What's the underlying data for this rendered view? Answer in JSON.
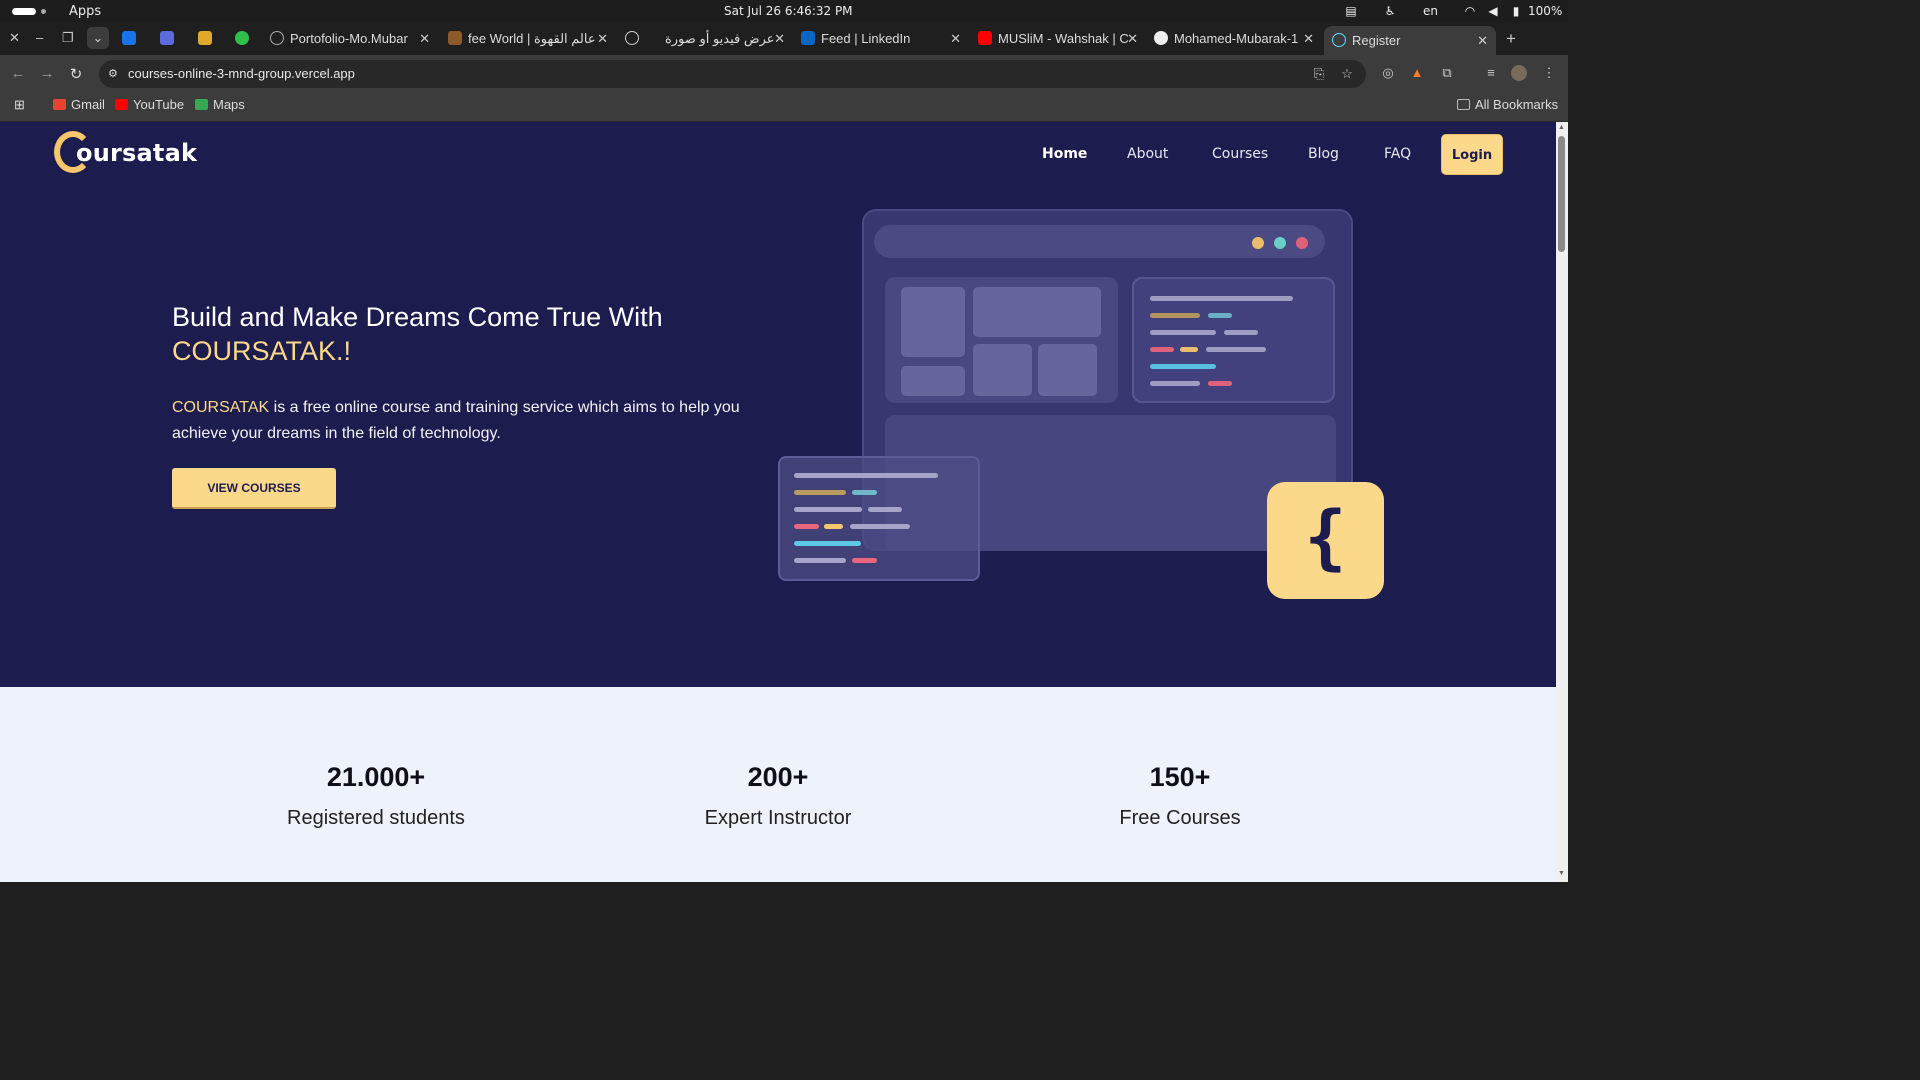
{
  "os": {
    "apps_label": "Apps",
    "clock": "Sat Jul 26   6:46:32 PM",
    "lang": "en",
    "battery": "100%"
  },
  "tabs": [
    {
      "label": "Portofolio-Mo.Mubar"
    },
    {
      "label": "fee World | عالم القهوة"
    },
    {
      "label": "عرض فيديو أو صورة"
    },
    {
      "label": "Feed | LinkedIn"
    },
    {
      "label": "MUSliM - Wahshak | C"
    },
    {
      "label": "Mohamed-Mubarak-1"
    },
    {
      "label": "Register"
    }
  ],
  "address_bar": {
    "url": "courses-online-3-mnd-group.vercel.app"
  },
  "bookmarks": {
    "items": [
      {
        "label": "Gmail"
      },
      {
        "label": "YouTube"
      },
      {
        "label": "Maps"
      }
    ],
    "all_bookmarks": "All Bookmarks"
  },
  "site": {
    "logo_text": "oursatak",
    "nav": {
      "home": "Home",
      "about": "About",
      "courses": "Courses",
      "blog": "Blog",
      "faq": "FAQ",
      "login": "Login"
    },
    "hero": {
      "title": "Build and Make Dreams Come True With",
      "title_brand": "COURSATAK.!",
      "lead_brand": "COURSATAK",
      "lead_rest": " is a free online course and training service which aims to help you achieve your dreams in the field of technology.",
      "cta": "VIEW COURSES",
      "brace": "{ }"
    },
    "stats": [
      {
        "value": "21.000+",
        "label": "Registered students"
      },
      {
        "value": "200+",
        "label": "Expert Instructor"
      },
      {
        "value": "150+",
        "label": "Free Courses"
      }
    ]
  },
  "colors": {
    "hero_bg": "#1d1c4f",
    "accent": "#fcd98a",
    "page_bg": "#eef2fa"
  }
}
